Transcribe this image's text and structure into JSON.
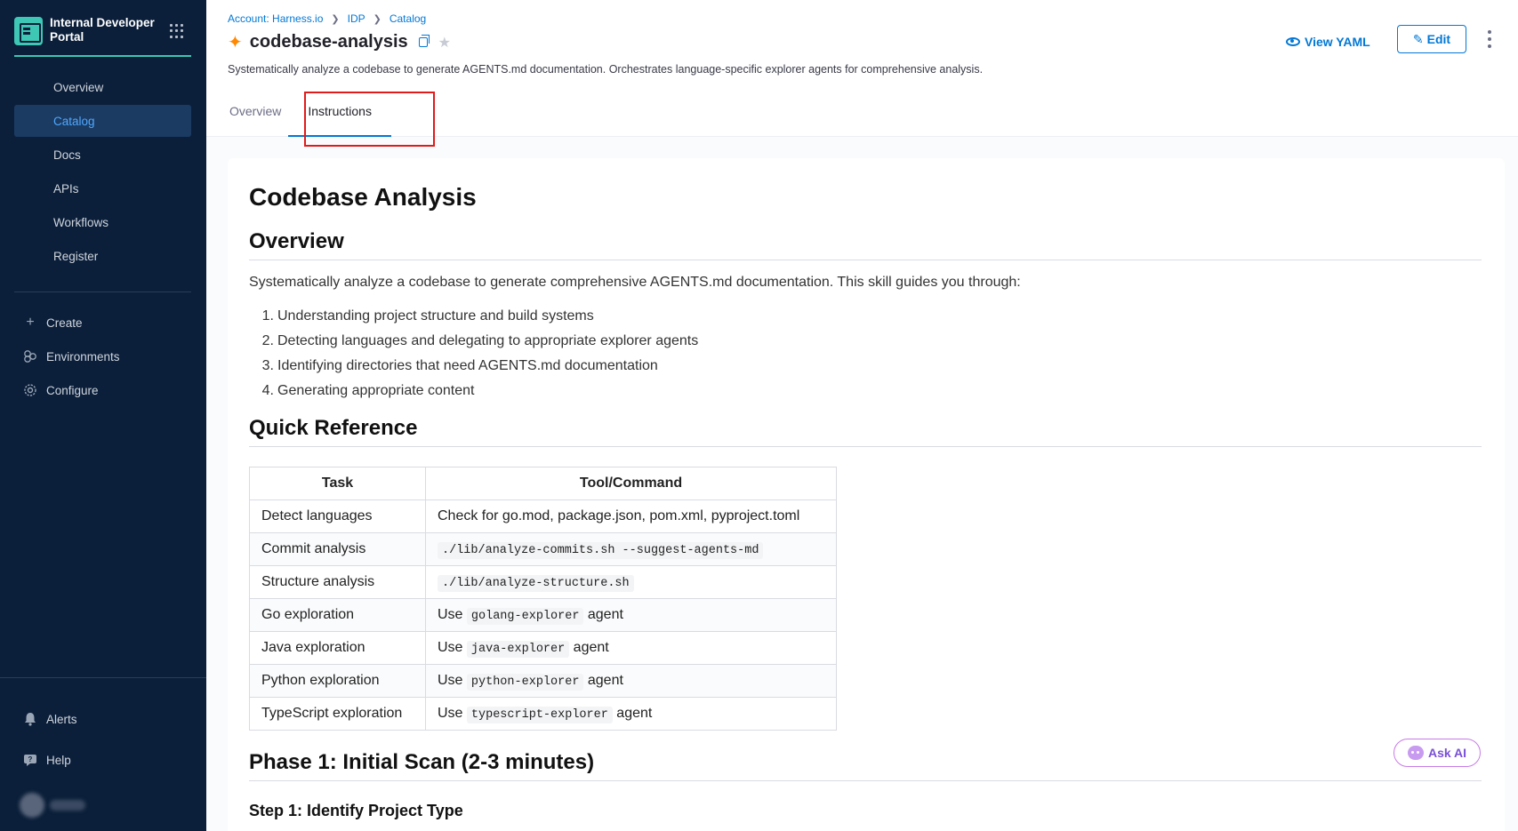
{
  "sidebar": {
    "brand": "Internal Developer Portal",
    "nav": [
      {
        "label": "Overview"
      },
      {
        "label": "Catalog",
        "active": true
      },
      {
        "label": "Docs"
      },
      {
        "label": "APIs"
      },
      {
        "label": "Workflows"
      },
      {
        "label": "Register"
      }
    ],
    "secondary": [
      {
        "label": "Create",
        "icon": "plus-icon"
      },
      {
        "label": "Environments",
        "icon": "environments-icon"
      },
      {
        "label": "Configure",
        "icon": "gear-icon"
      }
    ],
    "bottom": [
      {
        "label": "Alerts",
        "icon": "bell-icon"
      },
      {
        "label": "Help",
        "icon": "help-icon"
      }
    ]
  },
  "header": {
    "breadcrumb": [
      "Account: Harness.io",
      "IDP",
      "Catalog"
    ],
    "title": "codebase-analysis",
    "subtitle": "Systematically analyze a codebase to generate AGENTS.md documentation. Orchestrates language-specific explorer agents for comprehensive analysis.",
    "view_yaml": "View YAML",
    "edit": "Edit",
    "tabs": [
      {
        "label": "Overview"
      },
      {
        "label": "Instructions",
        "active": true
      }
    ]
  },
  "doc": {
    "h1": "Codebase Analysis",
    "overview_heading": "Overview",
    "overview_text": "Systematically analyze a codebase to generate comprehensive AGENTS.md documentation. This skill guides you through:",
    "steps": [
      {
        "num": "1.",
        "text": "Understanding project structure and build systems"
      },
      {
        "num": "2.",
        "text": "Detecting languages and delegating to appropriate explorer agents"
      },
      {
        "num": "3.",
        "text": "Identifying directories that need AGENTS.md documentation"
      },
      {
        "num": "4.",
        "text": "Generating appropriate content"
      }
    ],
    "quick_ref_heading": "Quick Reference",
    "table": {
      "headers": [
        "Task",
        "Tool/Command"
      ],
      "rows": [
        {
          "task": "Detect languages",
          "pre": "Check for go.mod, package.json, pom.xml, pyproject.toml",
          "code": "",
          "post": ""
        },
        {
          "task": "Commit analysis",
          "pre": "",
          "code": "./lib/analyze-commits.sh --suggest-agents-md",
          "post": ""
        },
        {
          "task": "Structure analysis",
          "pre": "",
          "code": "./lib/analyze-structure.sh",
          "post": ""
        },
        {
          "task": "Go exploration",
          "pre": "Use ",
          "code": "golang-explorer",
          "post": " agent"
        },
        {
          "task": "Java exploration",
          "pre": "Use ",
          "code": "java-explorer",
          "post": " agent"
        },
        {
          "task": "Python exploration",
          "pre": "Use ",
          "code": "python-explorer",
          "post": " agent"
        },
        {
          "task": "TypeScript exploration",
          "pre": "Use ",
          "code": "typescript-explorer",
          "post": " agent"
        }
      ]
    },
    "phase1_heading": "Phase 1: Initial Scan (2-3 minutes)",
    "step1_heading": "Step 1: Identify Project Type"
  },
  "ask_ai": "Ask AI",
  "colors": {
    "sidebar_bg": "#0b1f3a",
    "accent": "#0278d5",
    "brand_teal": "#3dc7b4",
    "highlight": "#e01b1b"
  }
}
